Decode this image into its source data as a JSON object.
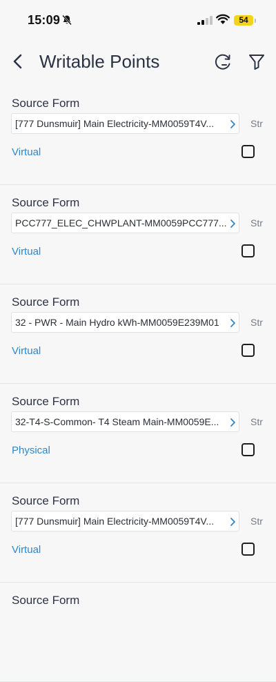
{
  "status_bar": {
    "time": "15:09",
    "battery": "54"
  },
  "header": {
    "title": "Writable Points"
  },
  "colors": {
    "accent": "#2f86c9",
    "battery": "#f5d21c",
    "title": "#2b3342"
  },
  "items": [
    {
      "label": "Source Form",
      "value": "[777 Dunsmuir] Main Electricity-MM0059T4V...",
      "str": "Str",
      "type": "Virtual"
    },
    {
      "label": "Source Form",
      "value": "PCC777_ELEC_CHWPLANT-MM0059PCC777...",
      "str": "Str",
      "type": "Virtual"
    },
    {
      "label": "Source Form",
      "value": "32 - PWR -  Main Hydro kWh-MM0059E239M01",
      "str": "Str",
      "type": "Virtual"
    },
    {
      "label": "Source Form",
      "value": "32-T4-S-Common- T4 Steam Main-MM0059E...",
      "str": "Str",
      "type": "Physical"
    },
    {
      "label": "Source Form",
      "value": "[777 Dunsmuir] Main Electricity-MM0059T4V...",
      "str": "Str",
      "type": "Virtual"
    },
    {
      "label": "Source Form"
    }
  ]
}
